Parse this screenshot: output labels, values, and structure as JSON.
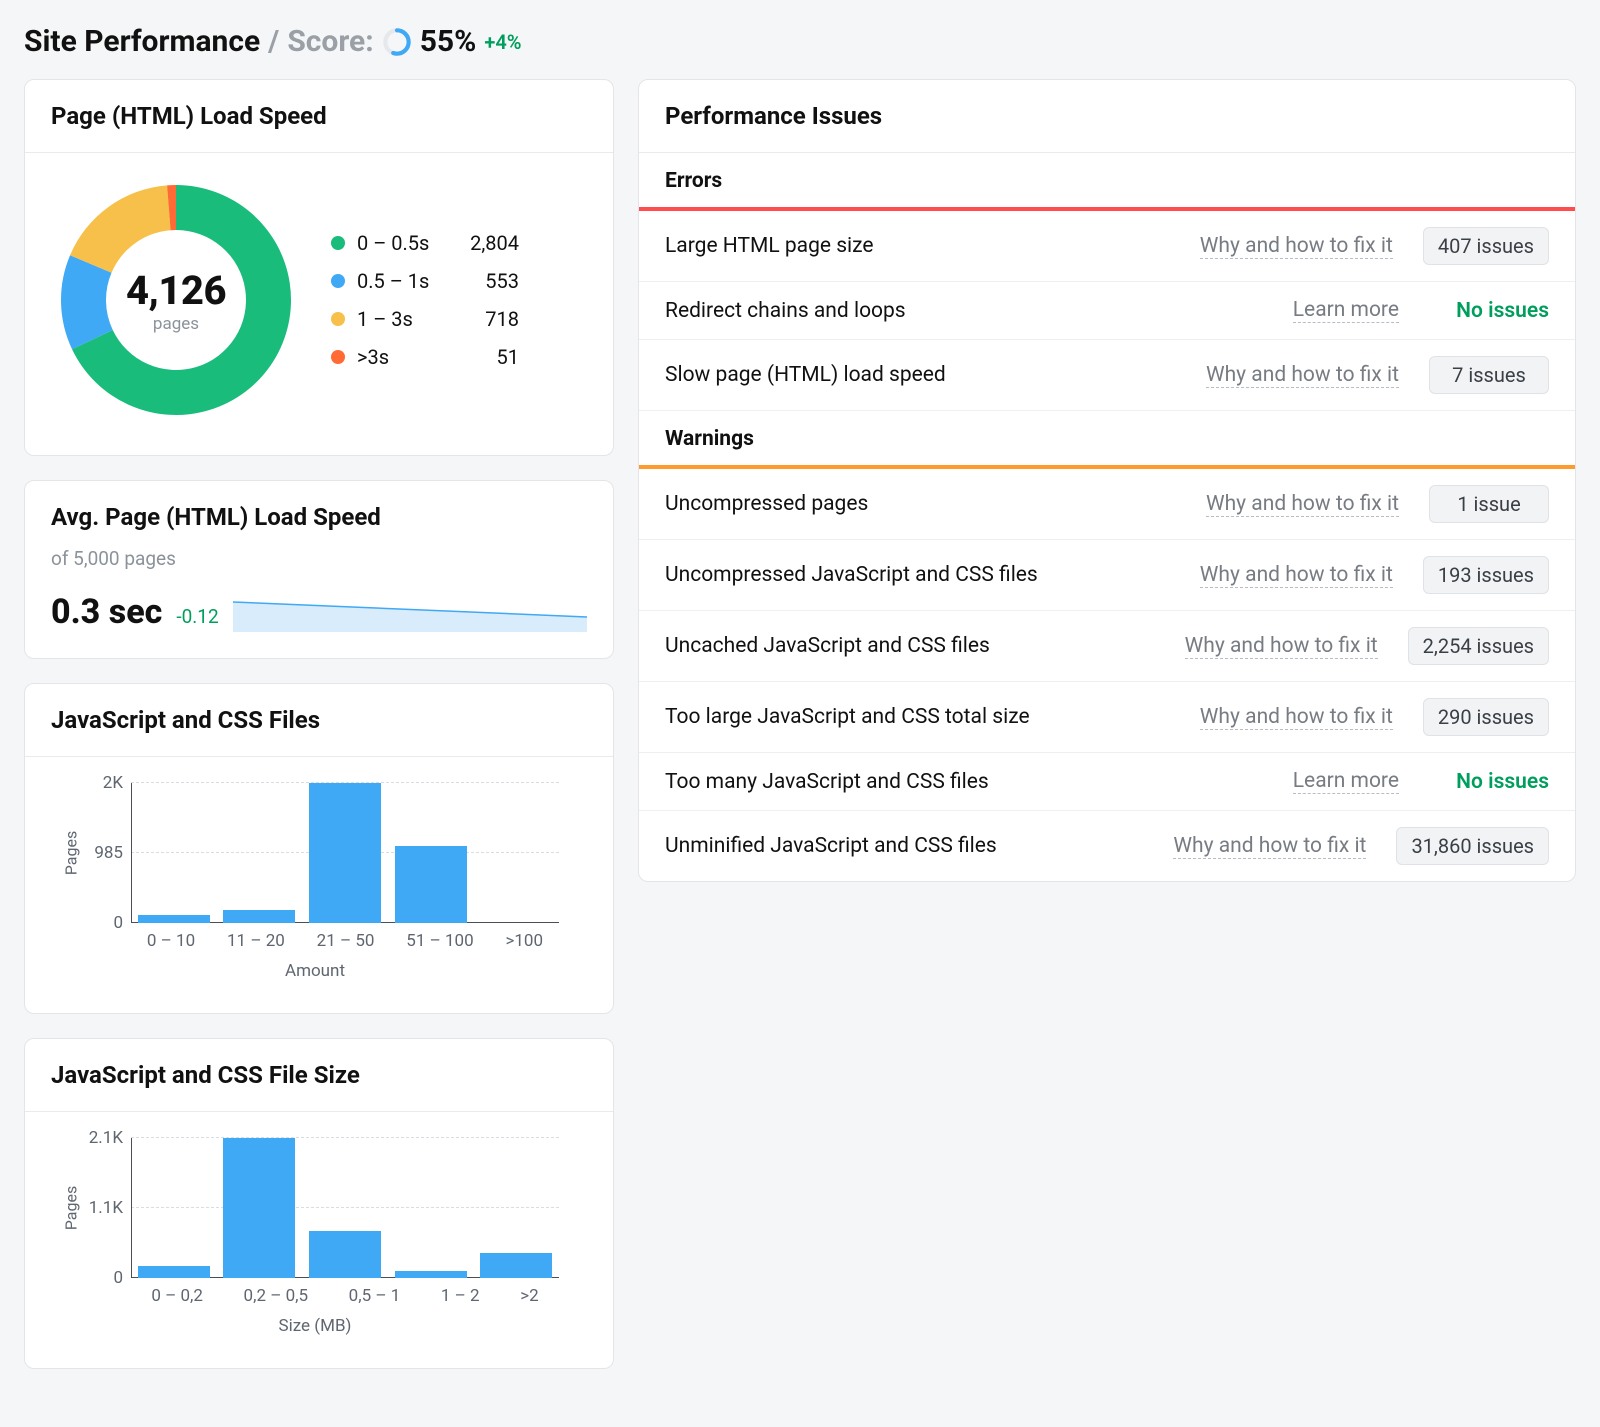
{
  "header": {
    "title": "Site Performance",
    "separator": "/",
    "score_label": "Score:",
    "score_pct": "55%",
    "score_value": 55,
    "delta": "+4%"
  },
  "donut_card": {
    "title": "Page (HTML) Load Speed",
    "center_value": "4,126",
    "center_label": "pages",
    "legend": [
      {
        "label": "0 – 0.5s",
        "value": "2,804",
        "count": 2804,
        "color": "#1abc7b"
      },
      {
        "label": "0.5 – 1s",
        "value": "553",
        "count": 553,
        "color": "#3fa9f5"
      },
      {
        "label": "1 – 3s",
        "value": "718",
        "count": 718,
        "color": "#f6c04a"
      },
      {
        "label": ">3s",
        "value": "51",
        "count": 51,
        "color": "#ff6a35"
      }
    ]
  },
  "avg_card": {
    "title": "Avg. Page (HTML) Load Speed",
    "subtitle": "of 5,000 pages",
    "value": "0.3 sec",
    "delta": "-0.12"
  },
  "bar_files": {
    "title": "JavaScript and CSS Files",
    "yticks": [
      "2K",
      "985",
      "0"
    ],
    "xlabel": "Amount",
    "ylabel": "Pages",
    "categories": [
      "0 – 10",
      "11 – 20",
      "21 – 50",
      "51 – 100",
      ">100"
    ],
    "values": [
      120,
      180,
      2000,
      1100,
      0
    ]
  },
  "bar_size": {
    "title": "JavaScript and CSS File Size",
    "yticks": [
      "2.1K",
      "1.1K",
      "0"
    ],
    "xlabel": "Size (MB)",
    "ylabel": "Pages",
    "categories": [
      "0 – 0,2",
      "0,2 – 0,5",
      "0,5 – 1",
      "1 – 2",
      ">2"
    ],
    "values": [
      180,
      2100,
      700,
      110,
      380
    ]
  },
  "issues": {
    "title": "Performance Issues",
    "sections": [
      {
        "kind": "errors",
        "label": "Errors",
        "rows": [
          {
            "title": "Large HTML page size",
            "link": "Why and how to fix it",
            "badge": "407 issues"
          },
          {
            "title": "Redirect chains and loops",
            "link": "Learn more",
            "no_issues": "No issues"
          },
          {
            "title": "Slow page (HTML) load speed",
            "link": "Why and how to fix it",
            "badge": "7 issues"
          }
        ]
      },
      {
        "kind": "warnings",
        "label": "Warnings",
        "rows": [
          {
            "title": "Uncompressed pages",
            "link": "Why and how to fix it",
            "badge": "1 issue"
          },
          {
            "title": "Uncompressed JavaScript and CSS files",
            "link": "Why and how to fix it",
            "badge": "193 issues"
          },
          {
            "title": "Uncached JavaScript and CSS files",
            "link": "Why and how to fix it",
            "badge": "2,254 issues"
          },
          {
            "title": "Too large JavaScript and CSS total size",
            "link": "Why and how to fix it",
            "badge": "290 issues"
          },
          {
            "title": "Too many JavaScript and CSS files",
            "link": "Learn more",
            "no_issues": "No issues"
          },
          {
            "title": "Unminified JavaScript and CSS files",
            "link": "Why and how to fix it",
            "badge": "31,860 issues"
          }
        ]
      }
    ]
  },
  "chart_data": [
    {
      "type": "pie",
      "title": "Page (HTML) Load Speed",
      "categories": [
        "0 – 0.5s",
        "0.5 – 1s",
        "1 – 3s",
        ">3s"
      ],
      "values": [
        2804,
        553,
        718,
        51
      ],
      "total": 4126,
      "center_label": "pages",
      "colors": [
        "#1abc7b",
        "#3fa9f5",
        "#f6c04a",
        "#ff6a35"
      ]
    },
    {
      "type": "bar",
      "title": "JavaScript and CSS Files",
      "xlabel": "Amount",
      "ylabel": "Pages",
      "categories": [
        "0 – 10",
        "11 – 20",
        "21 – 50",
        "51 – 100",
        ">100"
      ],
      "values": [
        120,
        180,
        2000,
        1100,
        0
      ],
      "ylim": [
        0,
        2000
      ]
    },
    {
      "type": "bar",
      "title": "JavaScript and CSS File Size",
      "xlabel": "Size (MB)",
      "ylabel": "Pages",
      "categories": [
        "0 – 0,2",
        "0,2 – 0,5",
        "0,5 – 1",
        "1 – 2",
        ">2"
      ],
      "values": [
        180,
        2100,
        700,
        110,
        380
      ],
      "ylim": [
        0,
        2100
      ]
    }
  ]
}
